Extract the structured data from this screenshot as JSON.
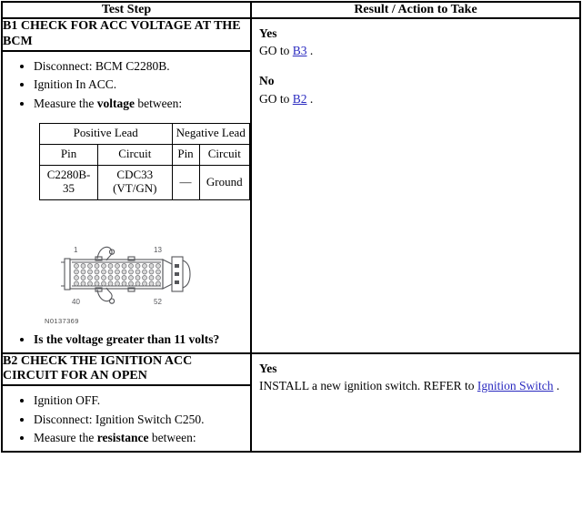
{
  "table": {
    "headers": {
      "test_step": "Test Step",
      "result_action": "Result / Action to Take"
    }
  },
  "steps": [
    {
      "id": "B1",
      "title": "B1 CHECK FOR ACC VOLTAGE AT THE BCM",
      "bullets": [
        "Disconnect: BCM C2280B.",
        "Ignition In ACC.",
        "Measure the voltage between:"
      ],
      "bullet_bold_terms": [
        "voltage"
      ],
      "pin_table": {
        "group_headers": {
          "positive": "Positive Lead",
          "negative": "Negative Lead"
        },
        "sub_headers": {
          "pos_pin": "Pin",
          "pos_circuit": "Circuit",
          "neg_pin": "Pin",
          "neg_circuit": "Circuit"
        },
        "rows": [
          {
            "pos_pin": "C2280B-35",
            "pos_circuit": "CDC33 (VT/GN)",
            "neg_pin": "—",
            "neg_circuit": "Ground"
          }
        ]
      },
      "figure": {
        "caption": "N0137369",
        "pin_labels": {
          "top_left": "1",
          "top_right": "13",
          "bottom_left": "40",
          "bottom_right": "52"
        },
        "alt": "BCM C2280B connector pin layout diagram"
      },
      "question": "Is the voltage greater than 11 volts?",
      "results": [
        {
          "label": "Yes",
          "text_before": "GO to ",
          "link": "B3",
          "text_after": " ."
        },
        {
          "label": "No",
          "text_before": "GO to ",
          "link": "B2",
          "text_after": " ."
        }
      ]
    },
    {
      "id": "B2",
      "title": "B2 CHECK THE IGNITION ACC CIRCUIT FOR AN OPEN",
      "bullets": [
        "Ignition OFF.",
        "Disconnect: Ignition Switch C250.",
        "Measure the resistance between:"
      ],
      "bullet_bold_terms": [
        "resistance"
      ],
      "results": [
        {
          "label": "Yes",
          "text_before": "INSTALL a new ignition switch. REFER to ",
          "link": "Ignition Switch",
          "text_after": " ."
        }
      ]
    }
  ],
  "colors": {
    "link": "#2a2ac0",
    "border": "#000000",
    "text": "#000000",
    "background": "#ffffff",
    "figure_line": "#4a4a4a"
  }
}
